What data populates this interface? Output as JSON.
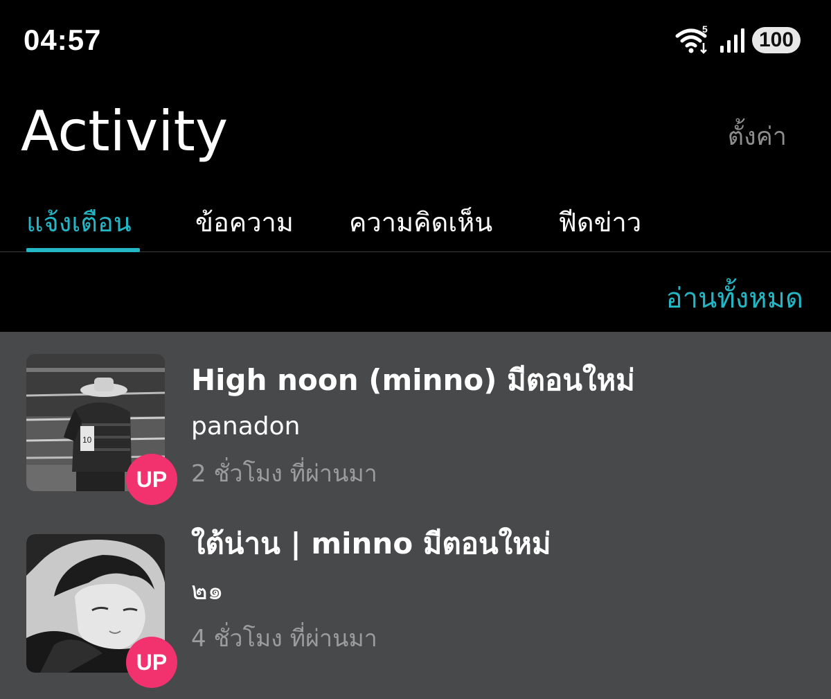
{
  "status_bar": {
    "time": "04:57",
    "wifi_icon": "wifi-icon",
    "wifi_generation": "5",
    "signal_icon": "signal-icon",
    "battery": "100"
  },
  "header": {
    "title": "Activity",
    "settings_label": "ตั้งค่า"
  },
  "tabs": [
    {
      "label": "แจ้งเตือน",
      "active": true
    },
    {
      "label": "ข้อความ",
      "active": false
    },
    {
      "label": "ความคิดเห็น",
      "active": false
    },
    {
      "label": "ฟีดข่าว",
      "active": false
    }
  ],
  "read_all_label": "อ่านทั้งหมด",
  "colors": {
    "accent": "#23b6c4",
    "badge": "#f2326e",
    "list_background": "#48494b"
  },
  "notifications": [
    {
      "title": "High noon (minno) มีตอนใหม่",
      "author": "panadon",
      "time": "2 ชั่วโมง ที่ผ่านมา",
      "badge": "UP",
      "thumbnail": "cowboy-photo"
    },
    {
      "title": "ใต้น่าน | minno มีตอนใหม่",
      "author": "๒๑",
      "time": "4 ชั่วโมง ที่ผ่านมา",
      "badge": "UP",
      "thumbnail": "portrait-photo"
    }
  ]
}
